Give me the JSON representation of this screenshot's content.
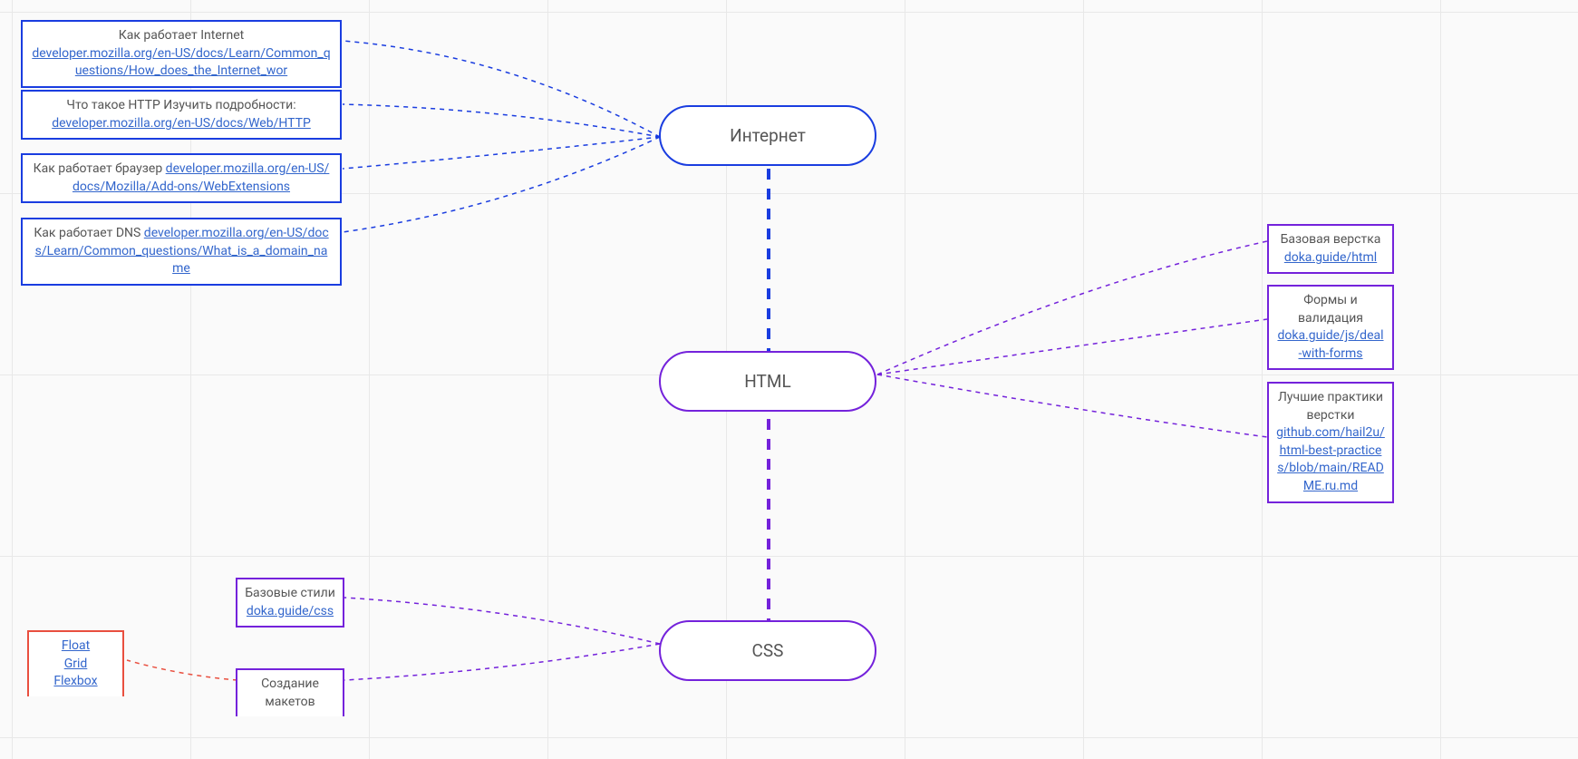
{
  "main_nodes": {
    "internet": "Интернет",
    "html": "HTML",
    "css": "CSS"
  },
  "internet_leaves": [
    {
      "text": "Как работает Internet",
      "link_text": "developer.mozilla.org/en-US/docs/Learn/Common_questions/How_does_the_Internet_wor"
    },
    {
      "text": "Что такое HTTP Изучить подробности:",
      "link_text": "developer.mozilla.org/en-US/docs/Web/HTTP"
    },
    {
      "text": "Как работает браузер",
      "link_text": "developer.mozilla.org/en-US/docs/Mozilla/Add-ons/WebExtensions",
      "inline": true
    },
    {
      "text": "Как работает DNS",
      "link_text": "developer.mozilla.org/en-US/docs/Learn/Common_questions/What_is_a_domain_name",
      "inline": true
    }
  ],
  "html_leaves": [
    {
      "text": "Базовая верстка",
      "link_text": "doka.guide/html"
    },
    {
      "text": "Формы и валидация",
      "link_text": "doka.guide/js/deal-with-forms"
    },
    {
      "text": "Лучшие практики верстки",
      "link_text": "github.com/hail2u/html-best-practices/blob/main/README.ru.md"
    }
  ],
  "css_leaves": [
    {
      "text": "Базовые стили",
      "link_text": "doka.guide/css"
    },
    {
      "text": "Создание макетов",
      "link_text": ""
    }
  ],
  "css_sub": {
    "links": [
      "Float",
      "Grid",
      "Flexbox"
    ]
  },
  "colors": {
    "blue": "#1a3de0",
    "purple": "#7422db",
    "red": "#e94f3f",
    "link": "#3366cc"
  }
}
